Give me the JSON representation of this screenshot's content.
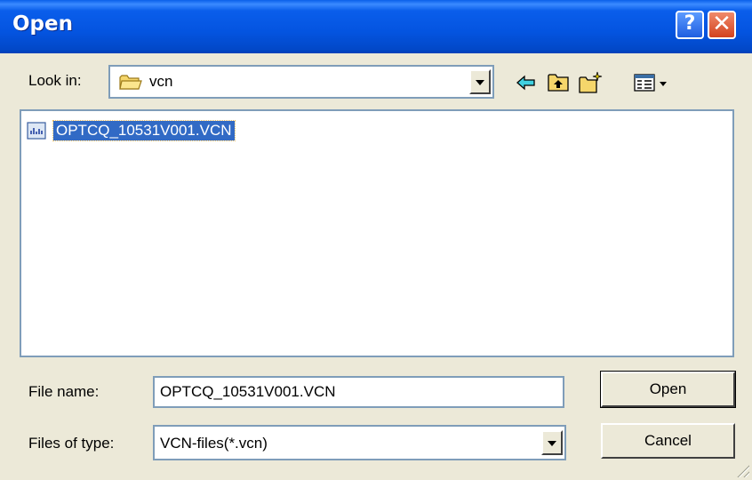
{
  "window": {
    "title": "Open"
  },
  "titlebar": {
    "help_label": "?",
    "close_label": "✕"
  },
  "lookin": {
    "label": "Look in:",
    "value": "vcn"
  },
  "files": [
    {
      "name": "OPTCQ_10531V001.VCN"
    }
  ],
  "filename": {
    "label": "File name:",
    "value": "OPTCQ_10531V001.VCN"
  },
  "filetype": {
    "label": "Files of type:",
    "value": "VCN-files(*.vcn)"
  },
  "buttons": {
    "open": "Open",
    "cancel": "Cancel"
  },
  "colors": {
    "titlebar": "#0454E0",
    "selection": "#316AC5",
    "dialog_bg": "#ECE9D8"
  }
}
